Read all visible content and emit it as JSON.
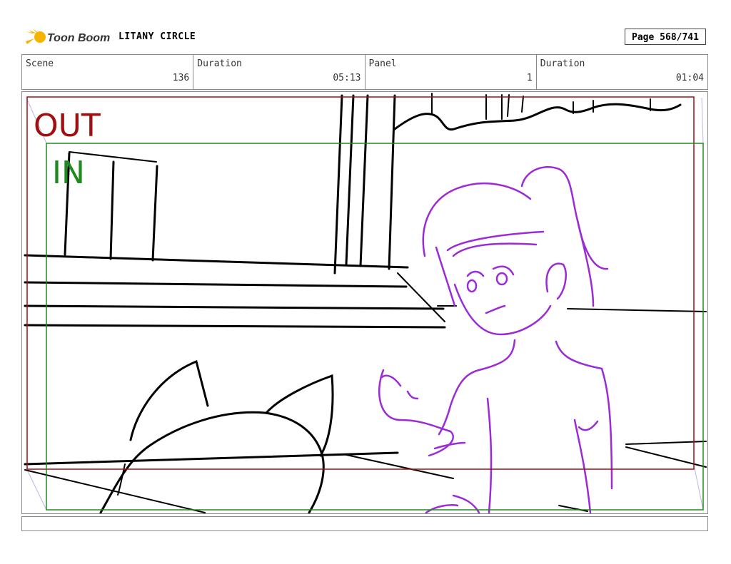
{
  "header": {
    "brand": "Toon Boom",
    "project_title": "LITANY CIRCLE",
    "page_label": "Page 568/741"
  },
  "info": {
    "scene_label": "Scene",
    "scene_value": "136",
    "scene_duration_label": "Duration",
    "scene_duration_value": "05:13",
    "panel_label": "Panel",
    "panel_value": "1",
    "panel_duration_label": "Duration",
    "panel_duration_value": "01:04"
  },
  "frames": {
    "out_label": "OUT",
    "in_label": "IN",
    "out_color": "#a01010",
    "in_color": "#1f8a1f"
  },
  "colors": {
    "sketch": "#000000",
    "character": "#9b2bd6"
  },
  "caption": {
    "text": ""
  }
}
